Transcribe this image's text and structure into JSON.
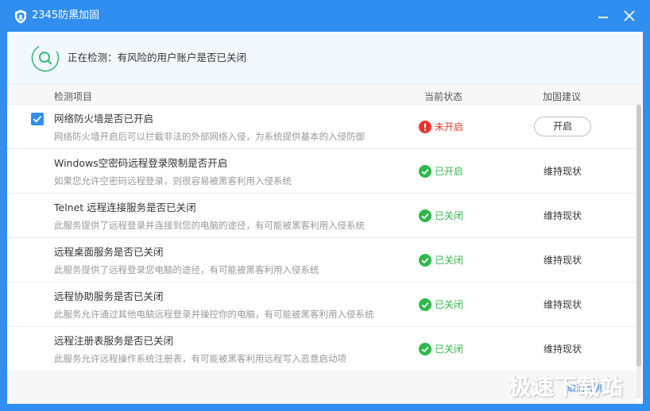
{
  "window": {
    "title": "2345防黑加固",
    "minimize_icon": "minimize-icon",
    "close_icon": "close-icon"
  },
  "status_bar": {
    "icon": "search-icon",
    "text": "正在检测：有风险的用户账户是否已关闭"
  },
  "table": {
    "columns": [
      "检测项目",
      "当前状态",
      "加固建议"
    ],
    "rows": [
      {
        "checked": true,
        "title": "网络防火墙是否已开启",
        "description": "网络防火墙开启后可以拦截非法的外部网络入侵，为系统提供基本的入侵防御",
        "status": "未开启",
        "status_type": "warning",
        "advice": "开启",
        "advice_is_button": true
      },
      {
        "checked": false,
        "title": "Windows空密码远程登录限制是否开启",
        "description": "如果您允许空密码远程登录，则很容易被黑客利用入侵系统",
        "status": "已开启",
        "status_type": "ok",
        "advice": "维持现状",
        "advice_is_button": false
      },
      {
        "checked": false,
        "title": "Telnet 远程连接服务是否已关闭",
        "description": "此服务提供了远程登录并连接到您的电脑的途径，有可能被黑客利用入侵系统",
        "status": "已关闭",
        "status_type": "ok",
        "advice": "维持现状",
        "advice_is_button": false
      },
      {
        "checked": false,
        "title": "远程桌面服务是否已关闭",
        "description": "此服务提供了远程登录您电脑的途径，有可能被黑客利用入侵系统",
        "status": "已关闭",
        "status_type": "ok",
        "advice": "维持现状",
        "advice_is_button": false
      },
      {
        "checked": false,
        "title": "远程协助服务是否已关闭",
        "description": "此服务允许通过其他电脑远程登录并操控你的电脑，有可能被黑客利用入侵系统",
        "status": "已关闭",
        "status_type": "ok",
        "advice": "维持现状",
        "advice_is_button": false
      },
      {
        "checked": false,
        "title": "远程注册表服务是否已关闭",
        "description": "此服务允许远程操作系统注册表，有可能被黑客利用远程写入恶意启动项",
        "status": "已关闭",
        "status_type": "ok",
        "advice": "维持现状",
        "advice_is_button": false
      }
    ]
  },
  "footer": {
    "link": "取消检测"
  },
  "watermark": "极速下载站",
  "colors": {
    "accent": "#2f8ef0",
    "warning": "#e8352c",
    "ok": "#2fb84a",
    "scan": "#3cb878"
  }
}
